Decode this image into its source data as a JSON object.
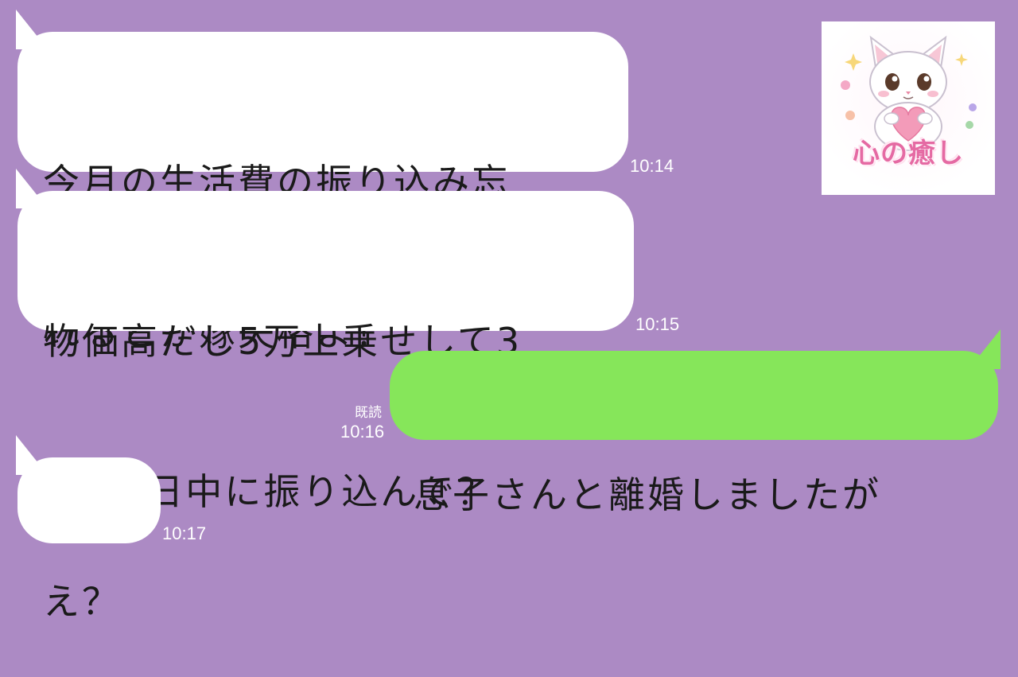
{
  "chat": {
    "background_color": "#ac8ac4",
    "incoming_bubble_color": "#ffffff",
    "outgoing_bubble_color": "#86e65a",
    "messages": [
      {
        "direction": "incoming",
        "lines": [
          "今月の生活費の振り込み忘",
          "れるとか嫁失格よ！"
        ],
        "time": "10:14"
      },
      {
        "direction": "incoming",
        "lines": [
          "物価高だし5万上乗せして3",
          "5万今日中に振り込んで？"
        ],
        "time": "10:15"
      },
      {
        "direction": "outgoing",
        "lines": [
          "息子さんと離婚しましたが"
        ],
        "read_label": "既読",
        "time": "10:16"
      },
      {
        "direction": "incoming",
        "lines": [
          "え？"
        ],
        "time": "10:17"
      }
    ]
  },
  "sticker": {
    "icon": "kitten-holding-heart-icon",
    "caption": "心の癒し"
  }
}
